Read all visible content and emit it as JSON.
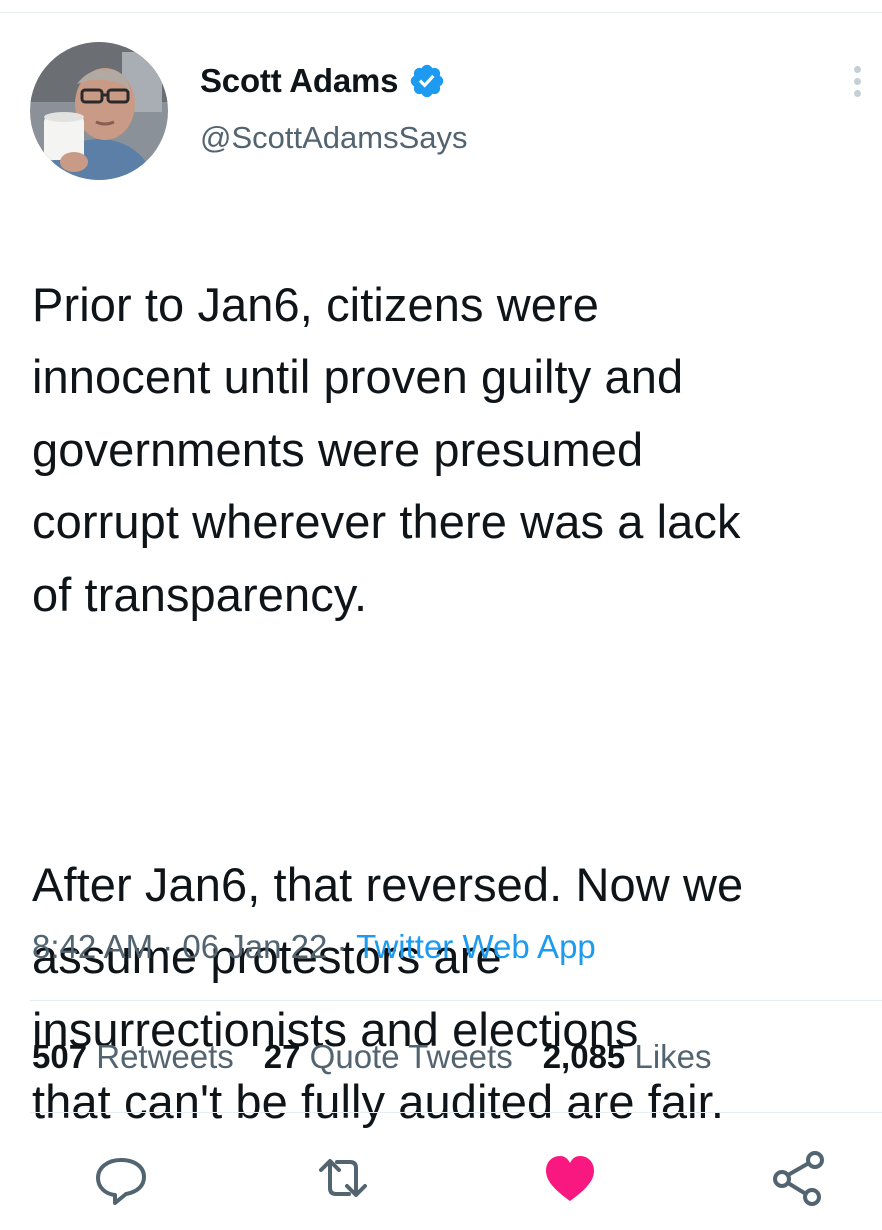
{
  "tweet": {
    "author": {
      "display_name": "Scott Adams",
      "handle": "@ScottAdamsSays",
      "verified": true
    },
    "text": {
      "paragraph_1": "Prior to Jan6, citizens were\ninnocent until proven guilty and\ngovernments were presumed\ncorrupt wherever there was a lack\nof transparency.",
      "paragraph_2": "After Jan6, that reversed. Now we\nassume protestors are\ninsurrectionists and elections\nthat can't be fully audited are fair."
    },
    "meta": {
      "time": "8:42 AM",
      "separator": " · ",
      "date": "06 Jan 22",
      "source": "Twitter Web App"
    },
    "stats": {
      "retweets_count": "507",
      "retweets_label": " Retweets",
      "quotes_count": "27",
      "quotes_label": " Quote Tweets",
      "likes_count": "2,085",
      "likes_label": " Likes"
    },
    "actions": [
      {
        "icon": "reply-icon"
      },
      {
        "icon": "retweet-icon"
      },
      {
        "icon": "like-icon",
        "active": true
      },
      {
        "icon": "share-icon"
      }
    ]
  },
  "colors": {
    "text": "#0f1419",
    "secondary": "#536471",
    "link": "#1d9bf0",
    "verified": "#1d9bf0",
    "like_active": "#f91880",
    "divider": "#e6ecf0"
  }
}
